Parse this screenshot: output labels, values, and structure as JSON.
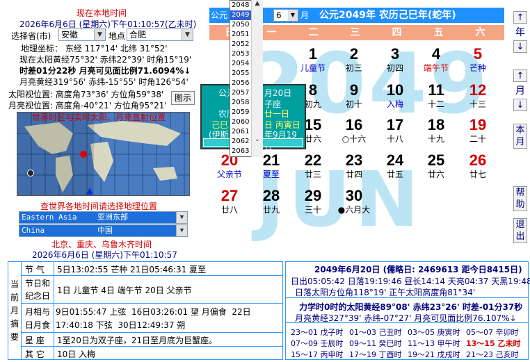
{
  "left": {
    "title": "现在本地时间",
    "local_time": "2026年6月6日 (星期六)下午01:10:57(乙未时)",
    "province_label": "选择省(市)",
    "province_value": "安徽",
    "place_label": "地点",
    "place_value": "合肥",
    "coords": "地理坐标：  东经 117°14'   北纬 31°52'",
    "sun_line": "现在太阳黄经75°32' 赤纬22°39' 时角15°19'",
    "diff_line": "时差01分22秒    月亮可见面比例71.6094%↓",
    "moon_line": "月亮黄经319°56' 赤纬-15°55' 时角126°54'",
    "sun_pos": "太阳视位置: 高度角73°36' 方位角59°38'",
    "moon_pos": "月亮视位置: 高度角-40°21' 方位角95°21'",
    "chart_button": "图示",
    "map_title": "世界时区与实时太阳、月亮直射位置",
    "world_prompt": "查世界各地时间请选择地理位置",
    "region_en": "Eastern Asia",
    "region_cn": "亚洲东部",
    "country_en": "China",
    "country_cn": "中国",
    "city_line": "北京、重庆、乌鲁木齐时间",
    "city_time": "2026年6月6日 (星期六)下午01:10:57"
  },
  "calendar": {
    "header_prefix": "公元",
    "month_value": "6",
    "month_suffix": "月",
    "header_title": "公元2049年  农历己巳年(蛇年)",
    "weekdays": [
      "日",
      "一",
      "二",
      "三",
      "四",
      "五",
      "六"
    ],
    "bg_year": "2049",
    "bg_month": "JUN",
    "days": [
      {
        "n": "1",
        "s": "儿童节",
        "sc": "blue"
      },
      {
        "n": "2",
        "s": "初三"
      },
      {
        "n": "3",
        "s": "初四"
      },
      {
        "n": "4",
        "s": "端午节",
        "sc": "red"
      },
      {
        "n": "5",
        "s": "芒种",
        "sc": "blue",
        "nc": "red"
      },
      {
        "n": "8",
        "s": "初九"
      },
      {
        "n": "9",
        "s": "初十"
      },
      {
        "n": "10",
        "s": "入梅",
        "sc": "blue"
      },
      {
        "n": "11",
        "s": "十二"
      },
      {
        "n": "12",
        "s": "十三",
        "nc": "red"
      },
      {
        "n": "15",
        "s": "廿六"
      },
      {
        "n": "16",
        "s": "○十六"
      },
      {
        "n": "17",
        "s": "十八"
      },
      {
        "n": "18",
        "s": "十九"
      },
      {
        "n": "19",
        "s": "二十",
        "nc": "red"
      },
      {
        "n": "20",
        "s": "父亲节",
        "sc": "blue",
        "nc": "red"
      },
      {
        "n": "21",
        "s": "夏至",
        "sc": "blue"
      },
      {
        "n": "22",
        "s": "廿三"
      },
      {
        "n": "23",
        "s": "廿四"
      },
      {
        "n": "24",
        "s": "廿五"
      },
      {
        "n": "25",
        "s": "廿六"
      },
      {
        "n": "26",
        "s": "廿七",
        "nc": "red"
      },
      {
        "n": "27",
        "s": "廿八",
        "nc": "red"
      },
      {
        "n": "28",
        "s": "廿九"
      },
      {
        "n": "29",
        "s": "三十"
      },
      {
        "n": "30",
        "s": "●六月大"
      }
    ],
    "year_list": [
      "2048",
      "2049",
      "2050",
      "2051",
      "2052",
      "2053",
      "2054",
      "2055",
      "2056",
      "2057",
      "2058",
      "2059",
      "2060",
      "2061",
      "2062",
      "2063"
    ],
    "popup": {
      "l1": "公元",
      "l1r": "月20日",
      "l2r": "子座",
      "l3": "农历",
      "l3r": "廿一日",
      "l4": "己巳",
      "l4r": "日 丙寅日",
      "l5": "(伊斯",
      "l5r": "年9月19日"
    }
  },
  "nav": {
    "year": "年",
    "month": "月",
    "this_month": "本月",
    "help": "帮助",
    "exit": "退出",
    "up": "↑",
    "down": "↓"
  },
  "bottom": {
    "side": [
      "当",
      "前",
      "月",
      "摘",
      "要"
    ],
    "rows": [
      {
        "label": "节  气",
        "value": "5日13:02:55 芒种    21日05:46:31 夏至"
      },
      {
        "label": "节日和\n纪念日",
        "value": "1日 儿童节 4日 端午节 20日 父亲节"
      },
      {
        "label": "月相与\n日月食",
        "value": "9日01:55:47 上弦  16日03:26:01 望 月偏食  22日\n17:40:18 下弦  30日12:49:37 朔"
      },
      {
        "label": "星  座",
        "value": "1至20日为双子座，21日至月底为巨蟹座。"
      },
      {
        "label": "其  它",
        "value": "10日 入梅"
      }
    ],
    "right_title": "2049年6月20日 (儒略日: 2469613  距今日8415日)",
    "r1": "日出05:05:42 日落19:19:46  昼长14:14  天亮04:37 天黑19:48",
    "r2": "日落太阳方位角118°19'  正午太阳高度角81°34'",
    "r3": "力学时0时的太阳黄经89°08' 赤纬23°26' 时差-01分37秒",
    "r4": "月亮黄经327°39' 赤纬-07°27'  月亮可见面比例76.107%↓",
    "hours": [
      [
        "23～01 戊子时",
        "01～03 己丑时",
        "03～05 庚寅时",
        "05～07 辛卯时"
      ],
      [
        "07～09 壬辰时",
        "09～11 癸巳时",
        "11～13 甲午时",
        "13～15 乙未时"
      ],
      [
        "15～17 丙申时",
        "17～19 丁酉时",
        "19～21 戊戌时",
        "21～23 己亥时"
      ]
    ]
  }
}
